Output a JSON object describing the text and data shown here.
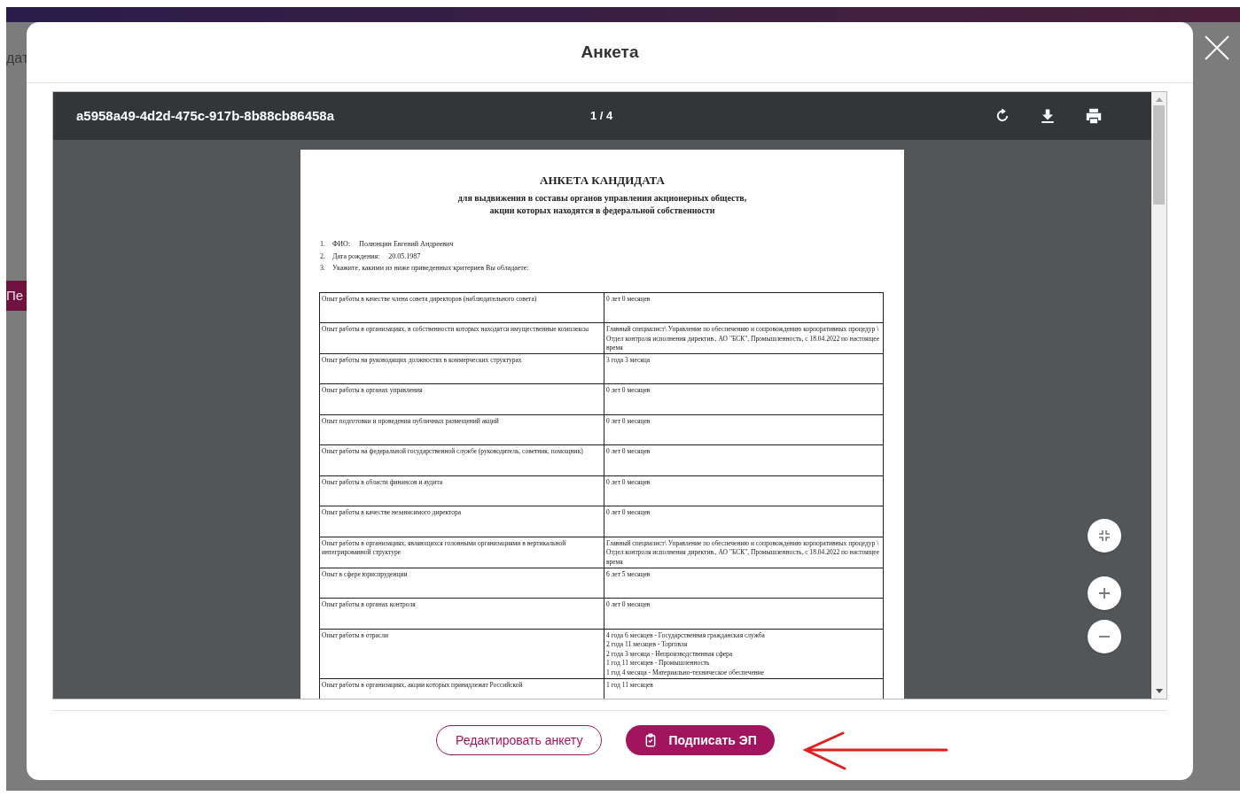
{
  "background": {
    "heading_fragment": "дат",
    "button_fragment": "Пе"
  },
  "dialog": {
    "title": "Анкета"
  },
  "viewer": {
    "file_name": "a5958a49-4d2d-475c-917b-8b88cb86458a",
    "page_counter": "1 / 4"
  },
  "document": {
    "title": "АНКЕТА КАНДИДАТА",
    "subtitle_lines": [
      "для выдвижения в составы органов управления акционерных обществ,",
      "акции которых находятся в федеральной собственности"
    ],
    "items": [
      {
        "number": "1.",
        "label": "ФИО:",
        "value": "Полюнцин Евгений Андреевич"
      },
      {
        "number": "2.",
        "label": "Дата рождения:",
        "value": "20.05.1987"
      },
      {
        "number": "3.",
        "label": "Укажите, какими из ниже приведенных критериев Вы обладаете:"
      }
    ],
    "table": {
      "rows": [
        {
          "criterion": "Опыт работы в качестве члена совета директоров (наблюдательного совета)",
          "answer_lines": [
            "0 лет 0 месяцев"
          ]
        },
        {
          "criterion": "Опыт работы в организациях, в собственности которых находятся имущественные комплексы",
          "answer_lines": [
            "Главный специалист\\ Управление по обеспечению и сопровождению корпоративных процедур \\ Отдел контроля исполнения директив., АО \"БСК\", Промышленность, с 18.04.2022 по настоящее время"
          ]
        },
        {
          "criterion": "Опыт работы на руководящих должностях в коммерческих структурах",
          "answer_lines": [
            "3 года 3 месяца"
          ]
        },
        {
          "criterion": "Опыт работы в органах управления",
          "answer_lines": [
            "0 лет 0 месяцев"
          ]
        },
        {
          "criterion": "Опыт подготовки и проведения публичных размещений акций",
          "answer_lines": [
            "0 лет 0 месяцев"
          ]
        },
        {
          "criterion": "Опыт работы на федеральной государственной службе (руководитель, советник, помощник)",
          "answer_lines": [
            "0 лет 0 месяцев"
          ]
        },
        {
          "criterion": "Опыт работы в области финансов и аудита",
          "answer_lines": [
            "0 лет 0 месяцев"
          ]
        },
        {
          "criterion": "Опыт работы в качестве независимого директора",
          "answer_lines": [
            "0 лет 0 месяцев"
          ]
        },
        {
          "criterion": "Опыт работы в организациях, являющихся головными организациями в вертикальной интегрированной структуре",
          "answer_lines": [
            "Главный специалист\\ Управление по обеспечению и сопровождению корпоративных процедур \\ Отдел контроля исполнения директив., АО \"БСК\", Промышленность, с 18.04.2022 по настоящее время"
          ]
        },
        {
          "criterion": "Опыт в сфере юриспруденции",
          "answer_lines": [
            "6 лет 5 месяцев"
          ]
        },
        {
          "criterion": "Опыт работы в органах контроля",
          "answer_lines": [
            "0 лет 0 месяцев"
          ]
        },
        {
          "criterion": "Опыт работы в отрасли",
          "answer_lines": [
            "4 года 6 месяцев - Государственная гражданская служба",
            "2 года 11 месяцев - Торговля",
            "2 года 3 месяца - Непроизводственная сфера",
            "1 год 11 месяцев - Промышленность",
            "1 год 4 месяца - Материально-техническое обеспечение"
          ]
        },
        {
          "criterion": "Опыт работы в организациях, акции которых принадлежат Российской",
          "answer_lines": [
            "1 год 11 месяцев"
          ]
        }
      ]
    }
  },
  "buttons": [
    {
      "label": "Редактировать анкету",
      "kind": "outline"
    },
    {
      "label": "Подписать ЭП",
      "kind": "primary"
    }
  ]
}
